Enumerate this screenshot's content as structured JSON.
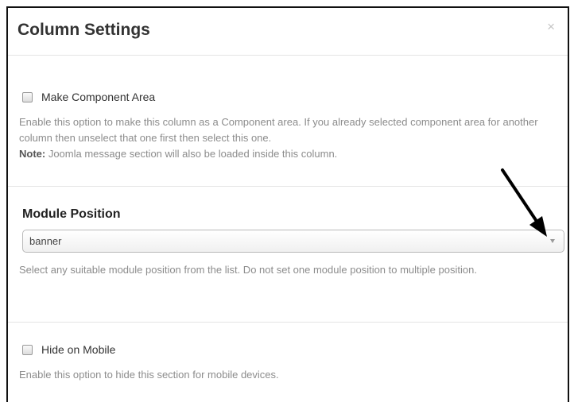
{
  "modal": {
    "title": "Column Settings",
    "close_label": "×"
  },
  "component_area": {
    "checkbox_label": "Make Component Area",
    "checked": false,
    "help": "Enable this option to make this column as a Component area. If you already selected component area for another column then unselect that one first then select this one.",
    "note_label": "Note:",
    "note_text": " Joomla message section will also be loaded inside this column."
  },
  "module_position": {
    "label": "Module Position",
    "selected_value": "banner",
    "help": "Select any suitable module position from the list. Do not set one module position to multiple position."
  },
  "hide_mobile": {
    "checkbox_label": "Hide on Mobile",
    "checked": false,
    "help": "Enable this option to hide this section for mobile devices."
  },
  "colors": {
    "help_text": "#8c8c8c",
    "arrow": "#000000"
  }
}
